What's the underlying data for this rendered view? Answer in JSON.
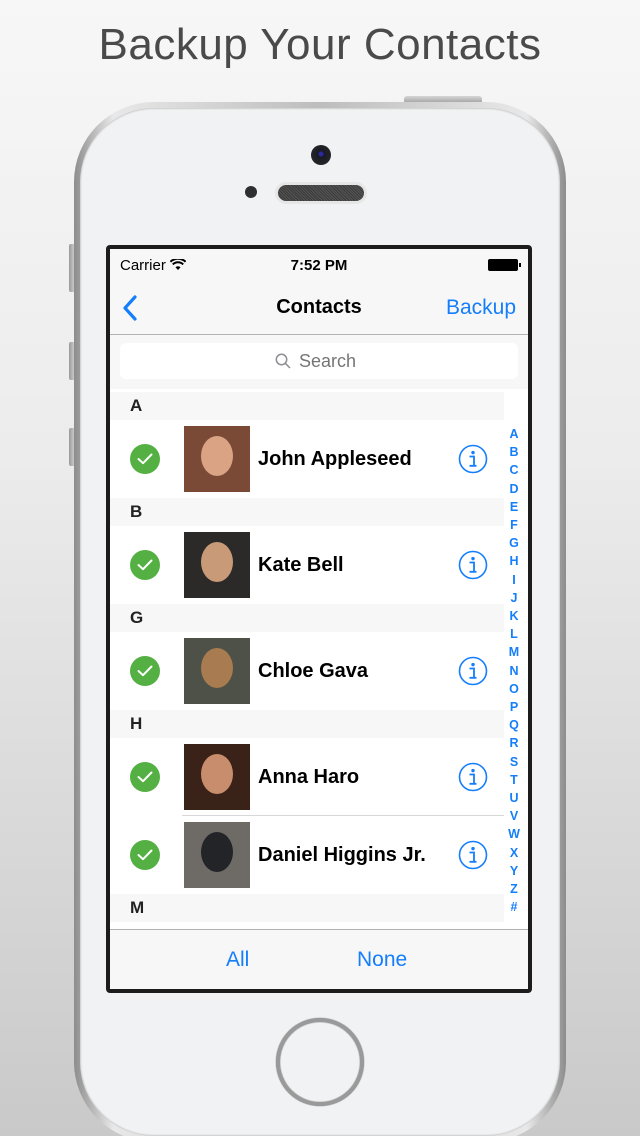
{
  "headline": "Backup Your Contacts",
  "status_bar": {
    "carrier": "Carrier",
    "time": "7:52 PM"
  },
  "nav": {
    "back_icon": "chevron-left-icon",
    "title": "Contacts",
    "backup_label": "Backup"
  },
  "search": {
    "placeholder": "Search",
    "value": ""
  },
  "sections": [
    {
      "letter": "A",
      "contacts": [
        {
          "name": "John Appleseed",
          "checked": true,
          "avatar_colors": [
            "#7a4a36",
            "#d9a384"
          ]
        }
      ]
    },
    {
      "letter": "B",
      "contacts": [
        {
          "name": "Kate Bell",
          "checked": true,
          "avatar_colors": [
            "#2c2a28",
            "#c89a78"
          ]
        }
      ]
    },
    {
      "letter": "G",
      "contacts": [
        {
          "name": "Chloe Gava",
          "checked": true,
          "avatar_colors": [
            "#4e5147",
            "#a87b50"
          ]
        }
      ]
    },
    {
      "letter": "H",
      "contacts": [
        {
          "name": "Anna Haro",
          "checked": true,
          "avatar_colors": [
            "#3a2218",
            "#c78d6c"
          ]
        },
        {
          "name": "Daniel Higgins Jr.",
          "checked": true,
          "avatar_colors": [
            "#6e6a66",
            "#222428"
          ]
        }
      ]
    },
    {
      "letter": "M",
      "contacts": []
    }
  ],
  "index": [
    "A",
    "B",
    "C",
    "D",
    "E",
    "F",
    "G",
    "H",
    "I",
    "J",
    "K",
    "L",
    "M",
    "N",
    "O",
    "P",
    "Q",
    "R",
    "S",
    "T",
    "U",
    "V",
    "W",
    "X",
    "Y",
    "Z",
    "#"
  ],
  "toolbar": {
    "all_label": "All",
    "none_label": "None"
  },
  "colors": {
    "accent": "#147efb",
    "check": "#55b043"
  }
}
